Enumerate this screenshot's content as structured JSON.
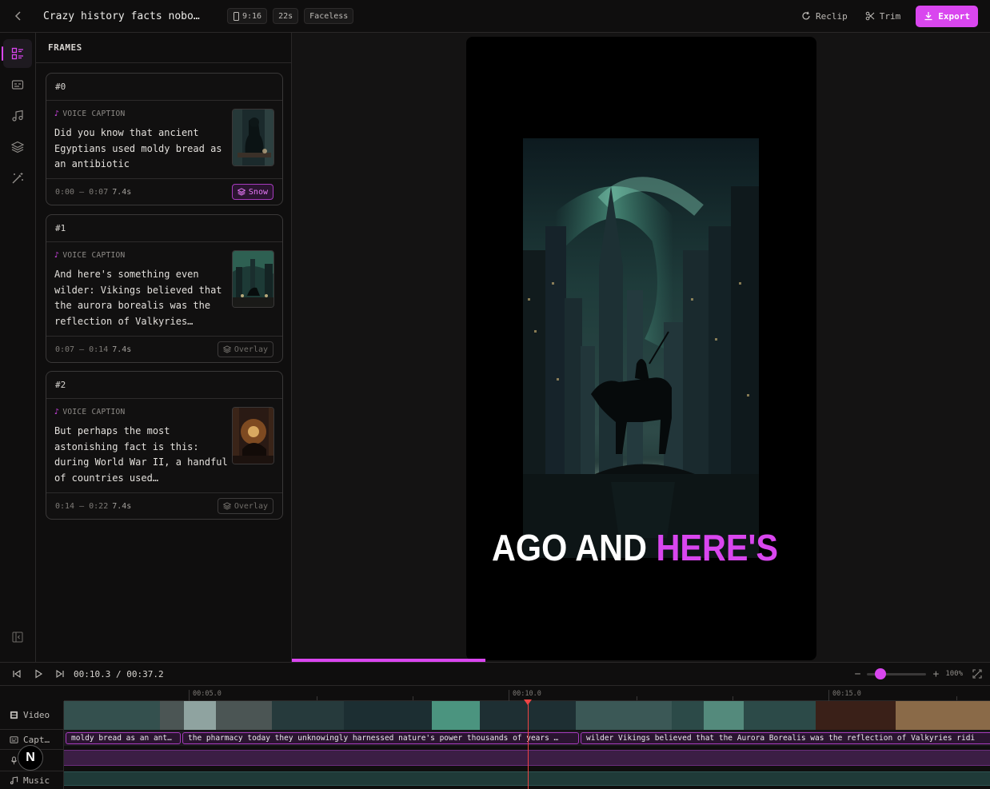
{
  "header": {
    "title": "Crazy history facts nobo…",
    "chips": [
      "9:16",
      "22s",
      "Faceless"
    ],
    "actions": {
      "reclip": "Reclip",
      "trim": "Trim",
      "export": "Export"
    }
  },
  "rail": {
    "items": [
      "frames-icon",
      "captions-icon",
      "music-icon",
      "layers-icon",
      "magic-wand-icon"
    ],
    "active": "frames-icon",
    "bottom": "collapse-sidebar-icon"
  },
  "frames": {
    "heading": "FRAMES",
    "items": [
      {
        "id": "#0",
        "label": "VOICE CAPTION",
        "text": "Did you know that ancient Egyptians used moldy bread as an antibiotic",
        "range": "0:00 – 0:07",
        "duration": "7.4s",
        "effect": "Snow"
      },
      {
        "id": "#1",
        "label": "VOICE CAPTION",
        "text": "And here's something even wilder: Vikings believed that the aurora borealis was the reflection of Valkyries…",
        "range": "0:07 – 0:14",
        "duration": "7.4s",
        "effect": "Overlay"
      },
      {
        "id": "#2",
        "label": "VOICE CAPTION",
        "text": "But perhaps the most astonishing fact is this: during World War II, a handful of countries used…",
        "range": "0:14 – 0:22",
        "duration": "7.4s",
        "effect": "Overlay"
      }
    ]
  },
  "preview": {
    "caption_white": "AGO AND ",
    "caption_pink": "HERE'S",
    "progress": 0.277
  },
  "timeline": {
    "current": "00:10.3",
    "sep": "/",
    "total": "00:37.2",
    "zoom": "100%",
    "ruler": [
      "00:05.0",
      "00:10.0",
      "00:15.0"
    ],
    "tracks": [
      "Video",
      "Capt…",
      "…",
      "Music"
    ],
    "captions": [
      "moldy bread as an ant…",
      "the pharmacy today they unknowingly harnessed nature's power thousands of years …",
      "wilder Vikings believed that the Aurora Borealis was the reflection of Valkyries ridi"
    ]
  },
  "fab": "N",
  "colors": {
    "accent": "#d946ef",
    "playhead": "#ef4444"
  }
}
